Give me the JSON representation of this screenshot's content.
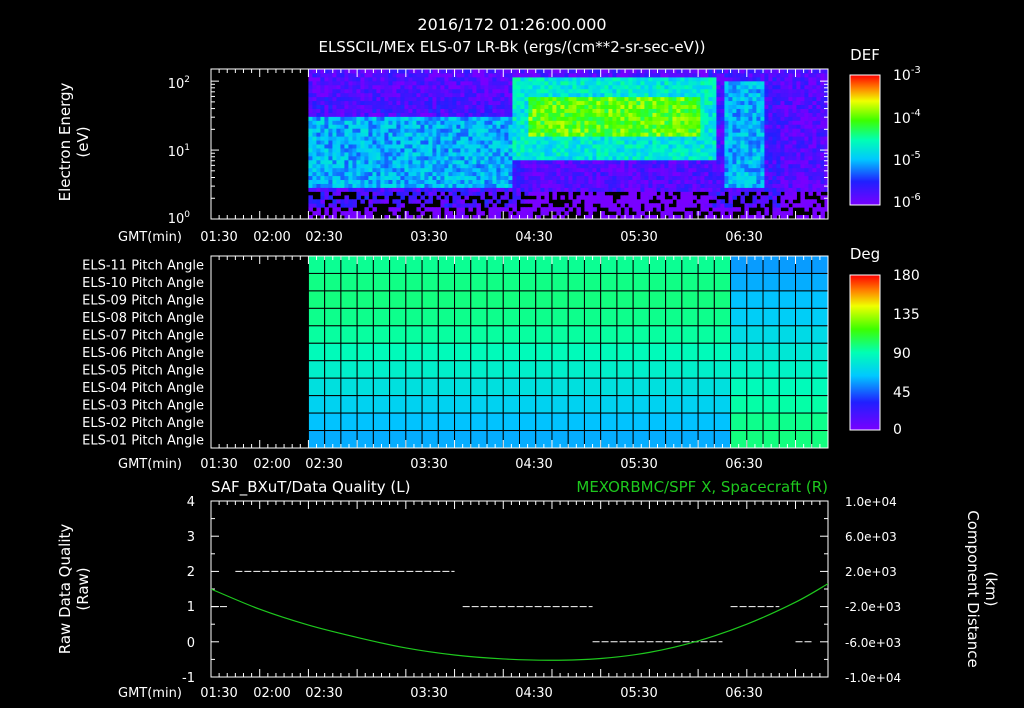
{
  "header": {
    "timestamp": "2016/172 01:26:00.000",
    "title": "ELSSCIL/MEx ELS-07 LR-Bk  (ergs/(cm**2-sr-sec-eV))"
  },
  "time_axis": {
    "label": "GMT(min)",
    "ticks_top": [
      "01:30",
      "02:00",
      "02:30",
      "03:30",
      "04:30",
      "05:30",
      "06:30"
    ],
    "ticks_bottom": [
      "01:30",
      "02:00",
      "02:30",
      "03:30",
      "04:30",
      "05:30",
      "06:30"
    ]
  },
  "chart_data": [
    {
      "type": "heatmap",
      "title": "ELSSCIL/MEx ELS-07 LR-Bk  (ergs/(cm**2-sr-sec-eV))",
      "ylabel_line1": "Electron Energy",
      "ylabel_line2": "(eV)",
      "y_scale": "log",
      "ylim": [
        1,
        150
      ],
      "yticks": [
        {
          "base": "10",
          "exp": "0",
          "value": 1
        },
        {
          "base": "10",
          "exp": "1",
          "value": 10
        },
        {
          "base": "10",
          "exp": "2",
          "value": 100
        }
      ],
      "xlim": [
        "01:30",
        "07:50"
      ],
      "data_start": "02:30",
      "colorbar": {
        "label": "DEF",
        "scale": "log",
        "range": [
          1e-06,
          0.001
        ],
        "ticks": [
          {
            "base": "10",
            "exp": "-3"
          },
          {
            "base": "10",
            "exp": "-4"
          },
          {
            "base": "10",
            "exp": "-5"
          },
          {
            "base": "10",
            "exp": "-6"
          }
        ]
      },
      "features": [
        {
          "time_range": [
            "02:30",
            "04:35"
          ],
          "energy_range_eV": [
            3,
            30
          ],
          "level": "1e-5"
        },
        {
          "time_range": [
            "04:45",
            "06:30"
          ],
          "energy_range_eV": [
            15,
            60
          ],
          "level": "1e-4"
        },
        {
          "time_range": [
            "06:45",
            "07:10"
          ],
          "energy_range_eV": [
            3,
            100
          ],
          "level": "1e-5"
        }
      ]
    },
    {
      "type": "heatmap",
      "channels": [
        "ELS-11 Pitch Angle",
        "ELS-10 Pitch Angle",
        "ELS-09 Pitch Angle",
        "ELS-08 Pitch Angle",
        "ELS-07 Pitch Angle",
        "ELS-06 Pitch Angle",
        "ELS-05 Pitch Angle",
        "ELS-04 Pitch Angle",
        "ELS-03 Pitch Angle",
        "ELS-02 Pitch Angle",
        "ELS-01 Pitch Angle"
      ],
      "channel_values_deg_early": [
        95,
        97,
        98,
        96,
        93,
        88,
        82,
        75,
        68,
        62,
        58
      ],
      "channel_values_deg_late": [
        55,
        58,
        62,
        66,
        72,
        78,
        84,
        88,
        92,
        96,
        98
      ],
      "late_start": "06:45",
      "xlim": [
        "01:30",
        "07:50"
      ],
      "data_start": "02:30",
      "colorbar": {
        "label": "Deg",
        "range": [
          0,
          180
        ],
        "ticks": [
          "180",
          "135",
          "90",
          "45",
          "0"
        ]
      }
    },
    {
      "type": "line",
      "left_title": "SAF_BXuT/Data Quality (L)",
      "right_title": "MEXORBMC/SPF X, Spacecraft (R)",
      "ylabel_left_line1": "Raw Data Quality",
      "ylabel_left_line2": "(Raw)",
      "ylabel_right_line1": "Component Distance",
      "ylabel_right_line2": "(km)",
      "ylim_left": [
        -1,
        4
      ],
      "yticks_left": [
        "4",
        "3",
        "2",
        "1",
        "0",
        "-1"
      ],
      "ylim_right": [
        -10000,
        10000
      ],
      "yticks_right": [
        "1.0e+04",
        "6.0e+03",
        "2.0e+03",
        "-2.0e+03",
        "-6.0e+03",
        "-1.0e+04"
      ],
      "xlim": [
        "01:30",
        "07:50"
      ],
      "series": [
        {
          "axis": "left",
          "style": "dashed",
          "color": "#ffffff",
          "segments": [
            {
              "x": [
                "01:30",
                "01:40"
              ],
              "y": 1
            },
            {
              "x": [
                "01:45",
                "04:00"
              ],
              "y": 2
            },
            {
              "x": [
                "04:05",
                "05:25"
              ],
              "y": 1
            },
            {
              "x": [
                "05:25",
                "06:45"
              ],
              "y": 0
            },
            {
              "x": [
                "06:50",
                "07:20"
              ],
              "y": 1
            },
            {
              "x": [
                "07:30",
                "07:40"
              ],
              "y": 0
            }
          ]
        },
        {
          "axis": "right",
          "style": "solid",
          "color": "#1ec81e",
          "x": [
            "01:30",
            "02:00",
            "02:30",
            "03:00",
            "03:30",
            "04:00",
            "04:30",
            "05:00",
            "05:30",
            "06:00",
            "06:30",
            "07:00",
            "07:30",
            "07:50"
          ],
          "y": [
            0,
            -2300,
            -4100,
            -5500,
            -6700,
            -7500,
            -7950,
            -8100,
            -7900,
            -7200,
            -5900,
            -4000,
            -1500,
            600
          ]
        }
      ]
    }
  ]
}
